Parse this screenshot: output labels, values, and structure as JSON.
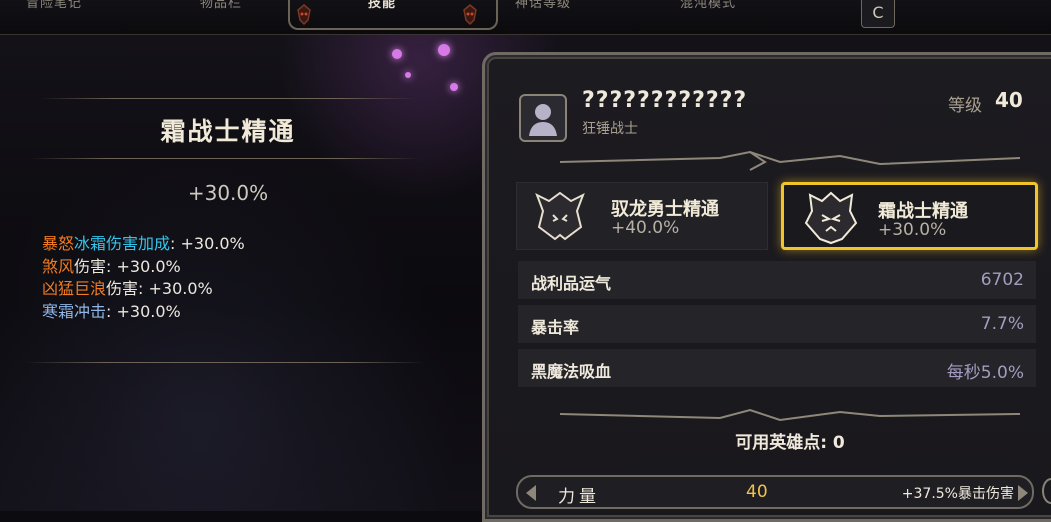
{
  "tabs": [
    {
      "label": "冒险笔记",
      "active": false
    },
    {
      "label": "物品栏",
      "active": false
    },
    {
      "label": "技能",
      "active": true
    },
    {
      "label": "神话等级",
      "active": false
    },
    {
      "label": "混沌模式",
      "active": false
    }
  ],
  "tab_hotkey": "C",
  "tooltip": {
    "title": "霜战士精通",
    "value": "+30.0%",
    "effects": [
      {
        "parts": [
          {
            "text": "暴怒",
            "color": "orange"
          },
          {
            "text": "冰霜伤害加成",
            "color": "cyan"
          },
          {
            "text": ": +30.0%",
            "color": "white"
          }
        ]
      },
      {
        "parts": [
          {
            "text": "煞风",
            "color": "orange"
          },
          {
            "text": "伤害: +30.0%",
            "color": "white"
          }
        ]
      },
      {
        "parts": [
          {
            "text": "凶猛巨浪",
            "color": "orange"
          },
          {
            "text": "伤害: +30.0%",
            "color": "white"
          }
        ]
      },
      {
        "parts": [
          {
            "text": "寒霜冲击",
            "color": "blue"
          },
          {
            "text": ": +30.0%",
            "color": "white"
          }
        ]
      }
    ]
  },
  "character": {
    "name": "????????????",
    "class": "狂锤战士",
    "level_label": "等级",
    "level": "40"
  },
  "masteries": [
    {
      "name": "驭龙勇士精通",
      "value": "+40.0%",
      "selected": false,
      "icon": "dragon-crest-icon"
    },
    {
      "name": "霜战士精通",
      "value": "+30.0%",
      "selected": true,
      "icon": "frost-demon-crest-icon"
    }
  ],
  "stats": [
    {
      "label": "战利品运气",
      "value": "6702"
    },
    {
      "label": "暴击率",
      "value": "7.7%"
    },
    {
      "label": "黑魔法吸血",
      "value": "每秒5.0%"
    }
  ],
  "hero_points": "可用英雄点: 0",
  "attribute": {
    "name": "力量",
    "value": "40",
    "bonus": "+37.5%暴击伤害"
  },
  "colors": {
    "orange": "#f07b20",
    "cyan": "#34c4ea",
    "blue": "#8fb6e6",
    "white": "#ece7dd",
    "selected_border": "#f1c42a",
    "attribute_value": "#f2c24a"
  }
}
